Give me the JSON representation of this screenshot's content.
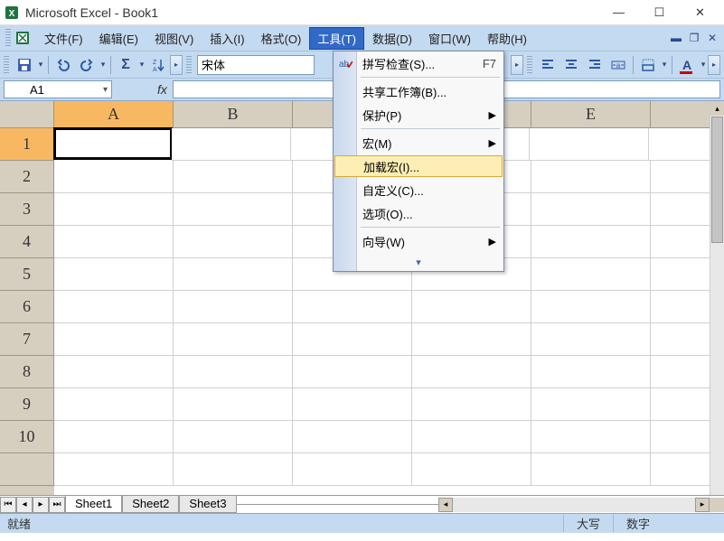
{
  "titlebar": {
    "title": "Microsoft Excel - Book1"
  },
  "menubar": {
    "items": [
      {
        "label": "文件(F)"
      },
      {
        "label": "编辑(E)"
      },
      {
        "label": "视图(V)"
      },
      {
        "label": "插入(I)"
      },
      {
        "label": "格式(O)"
      },
      {
        "label": "工具(T)"
      },
      {
        "label": "数据(D)"
      },
      {
        "label": "窗口(W)"
      },
      {
        "label": "帮助(H)"
      }
    ],
    "open_index": 5
  },
  "toolbar": {
    "font_name": "宋体"
  },
  "namebox": {
    "value": "A1",
    "fx": "fx"
  },
  "columns": [
    "A",
    "B",
    "C",
    "D",
    "E"
  ],
  "rows": [
    "1",
    "2",
    "3",
    "4",
    "5",
    "6",
    "7",
    "8",
    "9",
    "10"
  ],
  "active_col": 0,
  "active_row": 0,
  "sheets": {
    "tabs": [
      "Sheet1",
      "Sheet2",
      "Sheet3"
    ],
    "active": 0
  },
  "statusbar": {
    "ready": "就绪",
    "caps": "大写",
    "num": "数字"
  },
  "dropdown": {
    "items": [
      {
        "label": "拼写检查(S)...",
        "shortcut": "F7"
      },
      {
        "label": "共享工作簿(B)..."
      },
      {
        "label": "保护(P)",
        "submenu": true
      },
      {
        "label": "宏(M)",
        "submenu": true
      },
      {
        "label": "加载宏(I)...",
        "hover": true
      },
      {
        "label": "自定义(C)..."
      },
      {
        "label": "选项(O)..."
      },
      {
        "label": "向导(W)",
        "submenu": true
      }
    ]
  }
}
